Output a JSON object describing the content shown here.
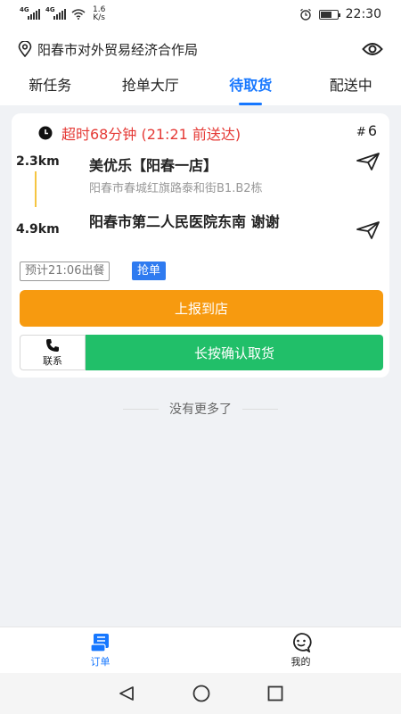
{
  "status_bar": {
    "network1": "4G",
    "network2": "4G",
    "speed_value": "1.6",
    "speed_unit": "K/s",
    "battery_level": 0.7,
    "time": "22:30"
  },
  "header": {
    "location": "阳春市对外贸易经济合作局",
    "location_icon": "map-pin-icon",
    "eye_icon": "eye-icon"
  },
  "tabs": [
    {
      "label": "新任务",
      "active": false
    },
    {
      "label": "抢单大厅",
      "active": false
    },
    {
      "label": "待取货",
      "active": true
    },
    {
      "label": "配送中",
      "active": false
    }
  ],
  "order": {
    "overtime": "超时68分钟 (21:21 前送达)",
    "number_hash": "#",
    "number": "6",
    "shop_distance": "2.3km",
    "shop_name": "美优乐【阳春一店】",
    "shop_address": "阳春市春城红旗路泰和街B1.B2栋",
    "customer_distance": "4.9km",
    "customer_name": "阳春市第二人民医院东南 谢谢",
    "eta": "预计21:06出餐",
    "tag": "抢单",
    "report_button": "上报到店",
    "contact_label": "联系",
    "confirm_button": "长按确认取货"
  },
  "list_footer": "没有更多了",
  "bottom_nav": [
    {
      "label": "订单",
      "icon": "order-scroll-icon",
      "active": true
    },
    {
      "label": "我的",
      "icon": "smiley-face-icon",
      "active": false
    }
  ],
  "colors": {
    "accent": "#1677ff",
    "overtime": "#e53935",
    "report": "#f79a0f",
    "confirm": "#21bf69",
    "route_line": "#f5c542"
  }
}
